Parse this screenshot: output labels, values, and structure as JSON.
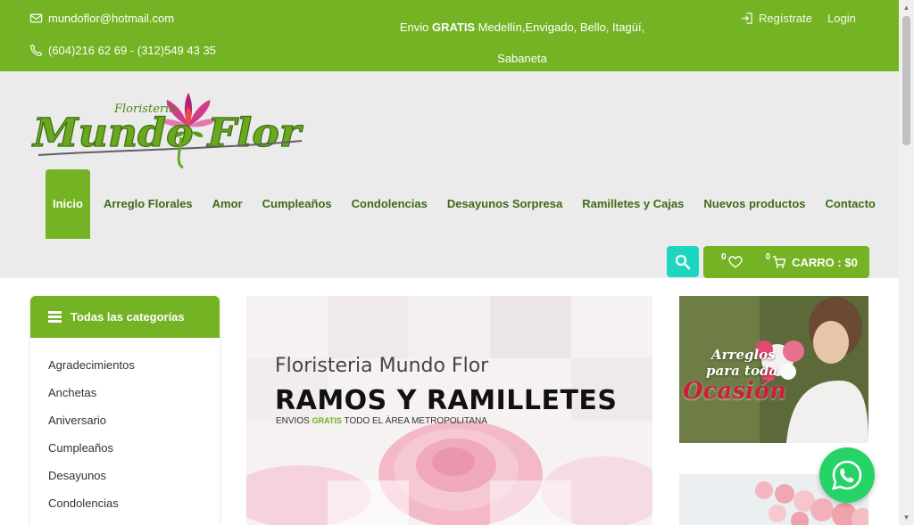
{
  "topbar": {
    "email": "mundoflor@hotmail.com",
    "phone": "(604)216 62 69 - (312)549 43 35",
    "shipping_prefix": "Envio ",
    "shipping_bold": "GRATIS",
    "shipping_rest": " Medellín,Envigado, Bello, Itagüí, Sabaneta",
    "register": "Regístrate",
    "login": "Login"
  },
  "logo": {
    "top": "Floristeria",
    "main": "Mundo Flor"
  },
  "nav": {
    "items": [
      "Inicio",
      "Arreglo Florales",
      "Amor",
      "Cumpleaños",
      "Condolencias",
      "Desayunos Sorpresa",
      "Ramilletes y Cajas",
      "Nuevos productos",
      "Contacto"
    ]
  },
  "cart": {
    "wishlist_count": "0",
    "cart_count": "0",
    "label": "CARRO : $0"
  },
  "sidebar": {
    "title": "Todas las categorías",
    "items": [
      "Agradecimientos",
      "Anchetas",
      "Aniversario",
      "Cumpleaños",
      "Desayunos",
      "Condolencias"
    ]
  },
  "banner": {
    "subtitle": "Floristeria Mundo Flor",
    "title": "RAMOS Y RAMILLETES",
    "line_prefix": "ENVIOS ",
    "line_green": "GRATIS",
    "line_rest": " TODO EL ÁREA METROPOLITANA"
  },
  "promo": {
    "line1": "Arreglos",
    "line2": "para toda",
    "line3": "Ocasión"
  },
  "colors": {
    "brand_green": "#74b324",
    "search_teal": "#1dd6c0",
    "whatsapp": "#25d366"
  }
}
